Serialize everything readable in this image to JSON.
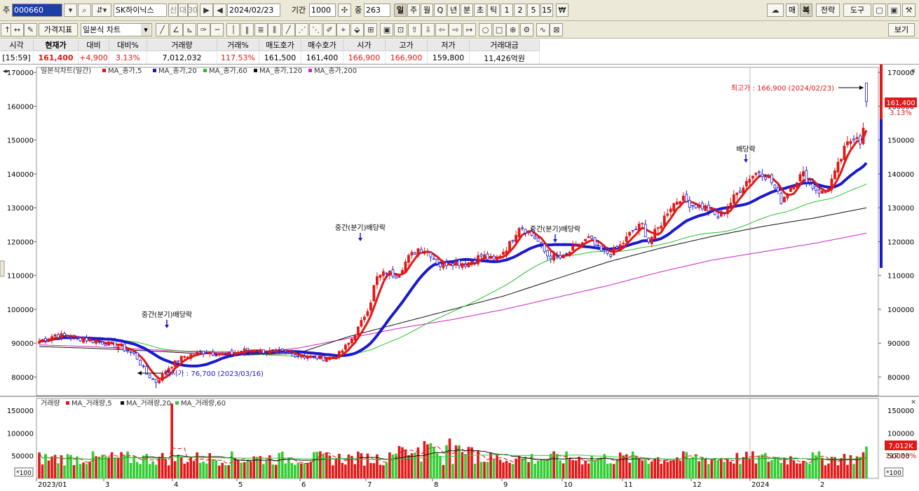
{
  "toolbar1": {
    "code_prefix": "주",
    "stock_code": "000660",
    "stock_name": "SK하이닉스",
    "tag1": "신",
    "tag2": "대",
    "tag3": "30",
    "date": "2024/02/23",
    "period_label": "기간",
    "period_value": "1000",
    "view_label": "중",
    "view_value": "263",
    "periods": [
      "일",
      "주",
      "월",
      "Q",
      "년",
      "분",
      "초",
      "틱",
      "1",
      "2",
      "5",
      "15",
      "₩"
    ],
    "active_period": "일",
    "right_buttons": [
      "매",
      "복",
      "전략",
      "도구"
    ],
    "active_right": "복"
  },
  "toolbar2": {
    "arrow1": "↑",
    "arrow2": "↔",
    "price_indicator": "가격지표",
    "chart_type": "일본식 차트",
    "view_button": "보기"
  },
  "quote": {
    "headers": [
      "시각",
      "현재가",
      "대비",
      "대비%",
      "거래량",
      "거래%",
      "매도호가",
      "매수호가",
      "시가",
      "고가",
      "저가",
      "거래대금"
    ],
    "values": [
      "[15:59]",
      "161,400",
      "+4,900",
      "3.13%",
      "7,012,032",
      "117.53%",
      "161,500",
      "161,400",
      "166,900",
      "166,900",
      "159,800",
      "11,426억원"
    ]
  },
  "legend": {
    "price_title": "일본식차트(일간)",
    "ma": [
      "MA_종가,5",
      "MA_종가,20",
      "MA_종가,60",
      "MA_종가,120",
      "MA_종가,200"
    ],
    "volume_title": "거래량",
    "vol_ma": [
      "MA_거래량,5",
      "MA_거래량,20",
      "MA_거래량,60"
    ]
  },
  "annotations": {
    "high": "최고가 : 166,900 (2024/02/23)",
    "low": "최저가 : 76,700 (2023/03/16)",
    "div1": "중간(분기)배당락",
    "div2": "중간(분기)배당락",
    "div3": "중간(분기)배당락",
    "div4": "배당락"
  },
  "badges": {
    "price_current": "161,400",
    "price_change": "3.13%",
    "vol_current": "7,012K",
    "vol_ratio": "117.53%",
    "vol_unit": "*100"
  },
  "colors": {
    "up": "#e01818",
    "down": "#1a1acc",
    "ma5": "#e01818",
    "ma20": "#1a1acc",
    "ma60": "#2bbf2b",
    "ma120": "#111111",
    "ma200": "#cc22cc",
    "vol_up": "#e01818",
    "vol_down": "#33cc33"
  },
  "chart_data": {
    "type": "candlestick",
    "y_range": [
      76700,
      166900
    ],
    "y_axis": [
      80000,
      90000,
      100000,
      110000,
      120000,
      130000,
      140000,
      150000,
      160000,
      170000
    ],
    "volume_axis": [
      50000,
      100000,
      150000
    ],
    "x_labels": [
      "2023/01",
      "3",
      "4",
      "5",
      "6",
      "7",
      "8",
      "9",
      "10",
      "11",
      "12",
      "2024",
      "2"
    ],
    "monthly_close": [
      91000,
      89000,
      85000,
      88000,
      86000,
      109000,
      117000,
      114000,
      117000,
      116000,
      121000,
      133000,
      141000,
      161400
    ],
    "ma120_points": [
      89000,
      88500,
      87800,
      87000,
      86500,
      87000,
      92000,
      96000,
      100000,
      104000,
      109000,
      114000,
      118000,
      121500,
      124500,
      127000,
      130000
    ],
    "ma200_points": [
      89500,
      89000,
      88200,
      87400,
      87000,
      88500,
      91500,
      94500,
      97000,
      100000,
      103500,
      107000,
      111000,
      114500,
      117000,
      119500,
      122500
    ]
  }
}
